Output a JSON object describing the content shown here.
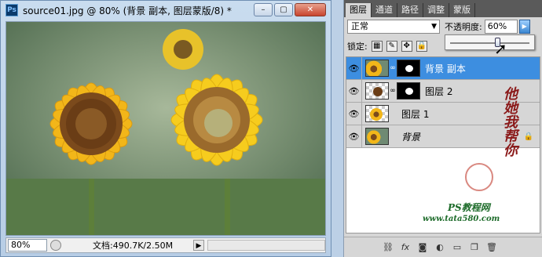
{
  "document": {
    "title": "source01.jpg @ 80% (背景 副本, 图层蒙版/8) *",
    "app_icon": "Ps",
    "window_buttons": [
      "minimize",
      "restore",
      "close"
    ],
    "status": {
      "zoom": "80%",
      "doc_info": "文档:490.7K/2.50M"
    }
  },
  "panel": {
    "tabs": [
      "图层",
      "通道",
      "路径",
      "调整",
      "蒙版"
    ],
    "active_tab": 0,
    "blend_mode": "正常",
    "opacity_label": "不透明度:",
    "opacity_value": "60%",
    "opacity_slider_fraction": 0.6,
    "lock_label": "锁定:",
    "layers": [
      {
        "name": "背景 副本",
        "selected": true,
        "has_mask": true,
        "visible": true
      },
      {
        "name": "图层 2",
        "selected": false,
        "has_mask": true,
        "visible": true
      },
      {
        "name": "图层 1",
        "selected": false,
        "has_mask": false,
        "visible": true
      },
      {
        "name": "背景",
        "selected": false,
        "has_mask": false,
        "visible": true,
        "locked": true
      }
    ],
    "bottom_icons": [
      "link-icon",
      "fx-icon",
      "mask-icon",
      "adjustment-icon",
      "folder-icon",
      "new-layer-icon",
      "trash-icon"
    ]
  },
  "watermark": {
    "line1": "他她我帮你",
    "line2": "PS教程网",
    "line3": "www.tata580.com"
  },
  "colors": {
    "selected_layer": "#3d8ee0",
    "panel_bg": "#d6d6d6",
    "title_bg": "#bcd0e6"
  }
}
